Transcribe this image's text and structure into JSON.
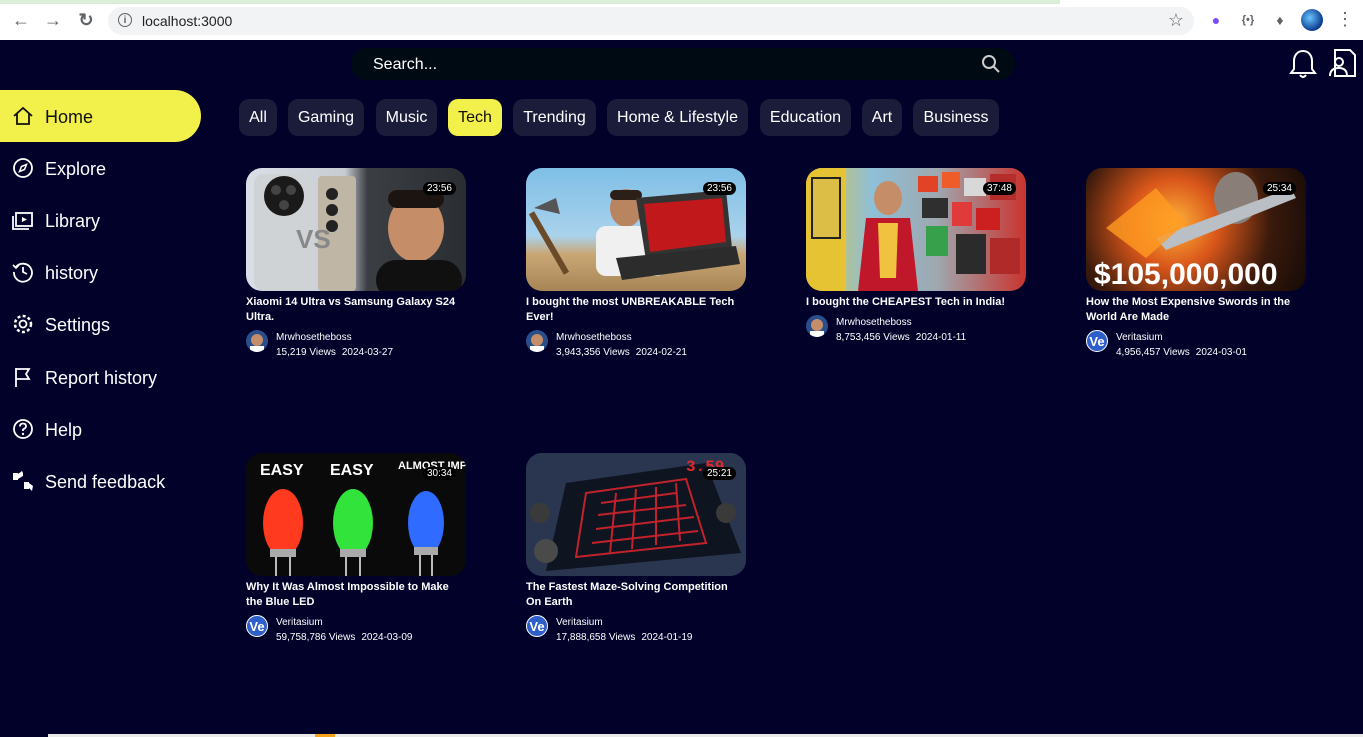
{
  "browser": {
    "url": "localhost:3000"
  },
  "search": {
    "placeholder": "Search..."
  },
  "sidebar": {
    "items": [
      {
        "label": "Home",
        "icon": "home-icon"
      },
      {
        "label": "Explore",
        "icon": "compass-icon"
      },
      {
        "label": "Library",
        "icon": "library-icon"
      },
      {
        "label": "history",
        "icon": "history-icon"
      },
      {
        "label": "Settings",
        "icon": "gear-icon"
      },
      {
        "label": "Report history",
        "icon": "flag-icon"
      },
      {
        "label": "Help",
        "icon": "help-icon"
      },
      {
        "label": "Send feedback",
        "icon": "feedback-icon"
      }
    ]
  },
  "chips": [
    "All",
    "Gaming",
    "Music",
    "Tech",
    "Trending",
    "Home & Lifestyle",
    "Education",
    "Art",
    "Business"
  ],
  "videos": [
    {
      "title": "Xiaomi 14 Ultra vs Samsung Galaxy S24 Ultra.",
      "channel": "Mrwhosetheboss",
      "views": "15,219 Views",
      "date": "2024-03-27",
      "duration": "23:56"
    },
    {
      "title": "I bought the most UNBREAKABLE Tech Ever!",
      "channel": "Mrwhosetheboss",
      "views": "3,943,356 Views",
      "date": "2024-02-21",
      "duration": "23:56"
    },
    {
      "title": "I bought the CHEAPEST Tech in India!",
      "channel": "Mrwhosetheboss",
      "views": "8,753,456 Views",
      "date": "2024-01-11",
      "duration": "37:48"
    },
    {
      "title": "How the Most Expensive Swords in the World Are Made",
      "channel": "Veritasium",
      "views": "4,956,457 Views",
      "date": "2024-03-01",
      "duration": "25:34",
      "overlay": "$105,000,000"
    },
    {
      "title": "Why It Was Almost Impossible to Make the Blue LED",
      "channel": "Veritasium",
      "views": "59,758,786 Views",
      "date": "2024-03-09",
      "duration": "30:34",
      "overlay_labels": [
        "EASY",
        "EASY",
        "ALMOST IMPOSSIBLE"
      ]
    },
    {
      "title": "The Fastest Maze-Solving Competition On Earth",
      "channel": "Veritasium",
      "views": "17,888,658 Views",
      "date": "2024-01-19",
      "duration": "25:21",
      "overlay": "3.59"
    }
  ],
  "colors": {
    "background": "#01012a",
    "accent": "#f2f04b",
    "chip": "#1b1c3a"
  }
}
